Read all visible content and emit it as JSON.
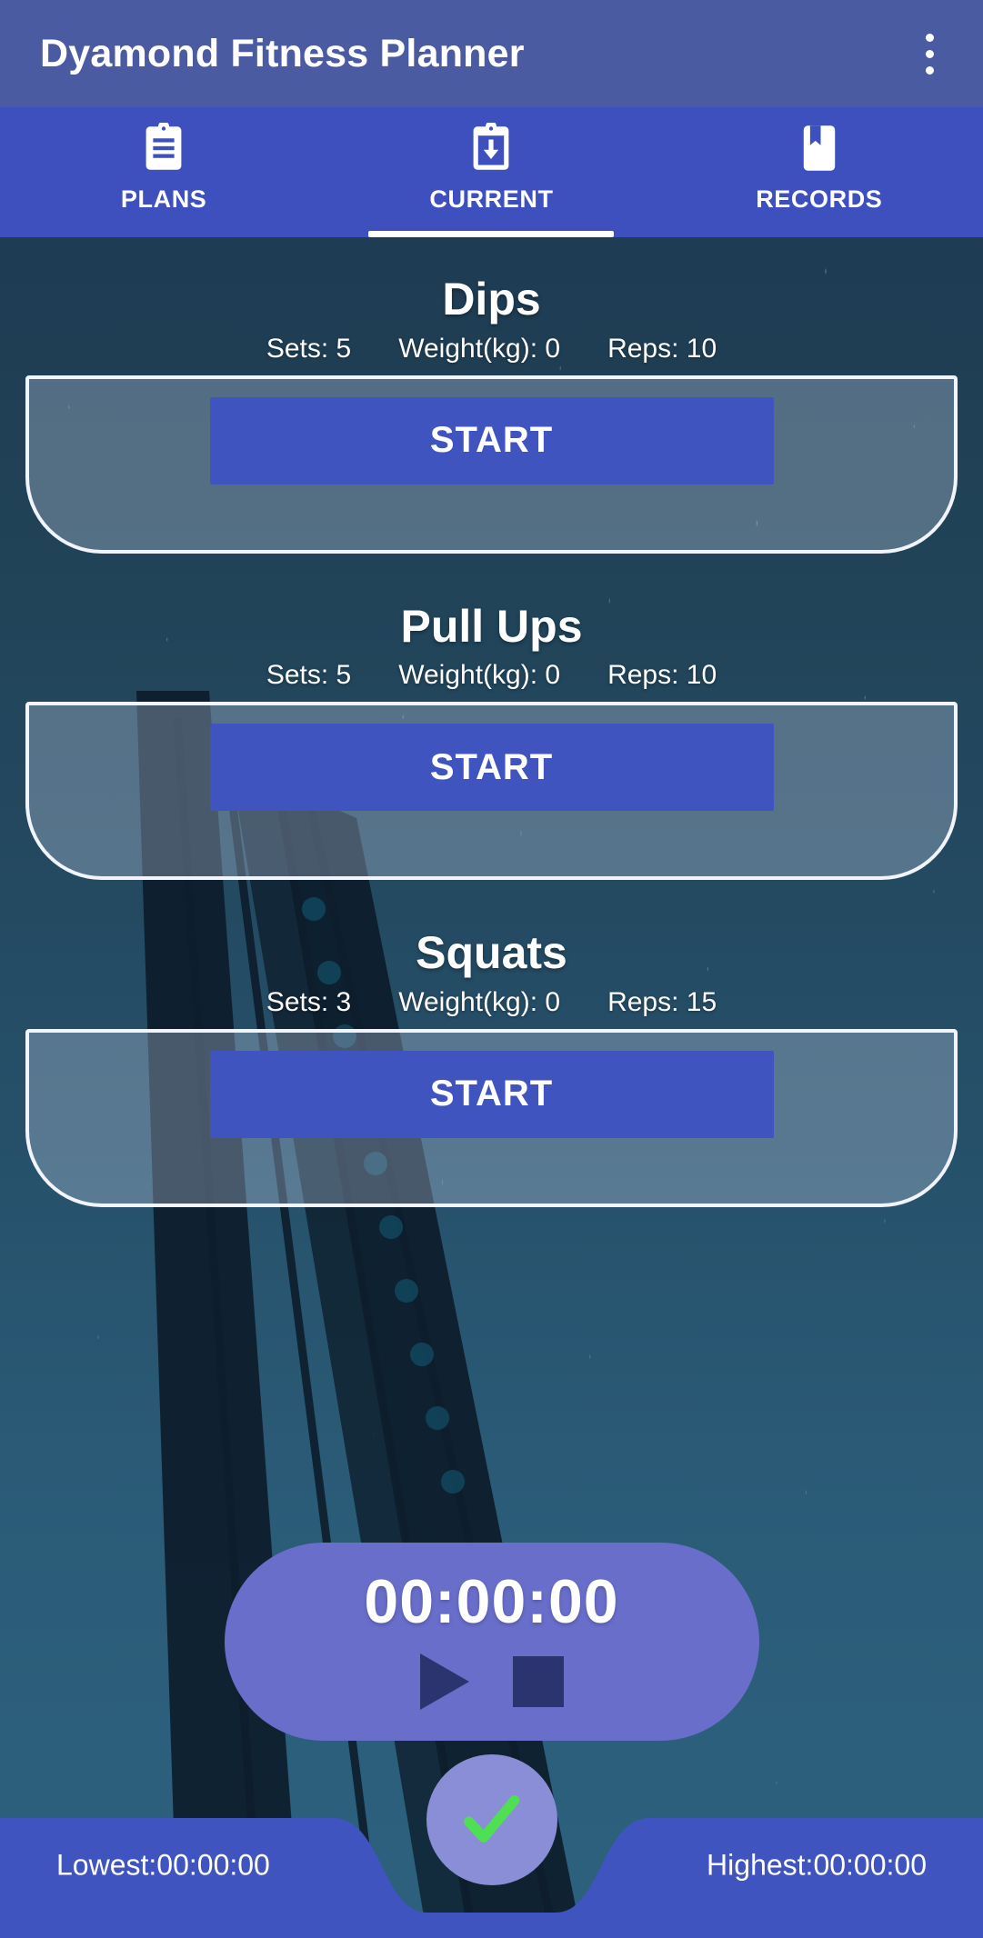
{
  "app": {
    "title": "Dyamond Fitness Planner",
    "overflow_icon": "more-vert-icon",
    "appbar_color": "#4b5ba2",
    "tabbar_color": "#3d50bd",
    "accent_color": "#4054c0",
    "timer_color": "#696ecb",
    "fab_color": "#8a8ed6",
    "check_color": "#4ee052"
  },
  "tabs": [
    {
      "label": "PLANS",
      "icon": "clipboard-list-icon",
      "selected": false
    },
    {
      "label": "CURRENT",
      "icon": "clipboard-down-icon",
      "selected": true
    },
    {
      "label": "RECORDS",
      "icon": "bookmark-icon",
      "selected": false
    }
  ],
  "exercises": [
    {
      "name": "Dips",
      "sets": "Sets: 5",
      "weight": "Weight(kg): 0",
      "reps": "Reps: 10",
      "start_label": "START"
    },
    {
      "name": "Pull Ups",
      "sets": "Sets: 5",
      "weight": "Weight(kg): 0",
      "reps": "Reps: 10",
      "start_label": "START"
    },
    {
      "name": "Squats",
      "sets": "Sets: 3",
      "weight": "Weight(kg): 0",
      "reps": "Reps: 15",
      "start_label": "START"
    }
  ],
  "timer": {
    "display": "00:00:00",
    "play_icon": "play-icon",
    "stop_icon": "stop-icon"
  },
  "bottom": {
    "lowest": "Lowest:00:00:00",
    "highest": "Highest:00:00:00",
    "fab_icon": "check-icon"
  }
}
